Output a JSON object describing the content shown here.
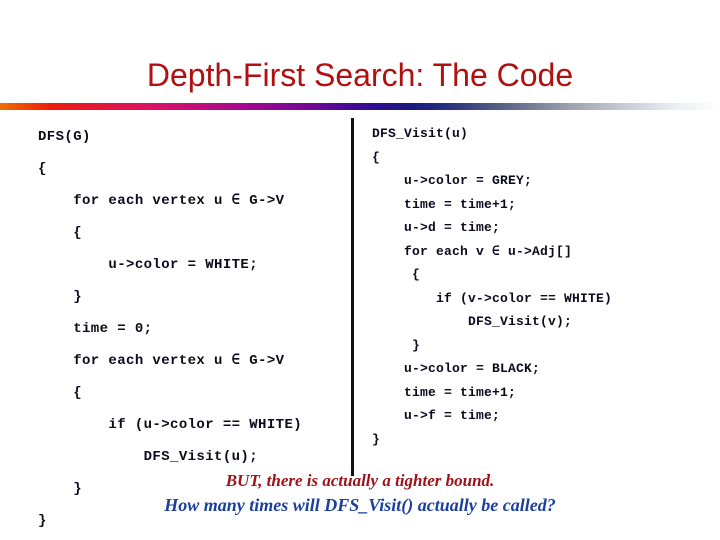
{
  "slide": {
    "title": "Depth-First Search: The Code",
    "title_color": "#b01010",
    "background_color": "#ffffff",
    "divider_color": "#111111"
  },
  "rule": {
    "name": "title-gradient-rule",
    "stops": [
      "#f07000",
      "#ee1b0c",
      "#d9106a",
      "#a9088e",
      "#7a0697",
      "#3b0b95",
      "#161a80",
      "#5a6386",
      "#9aa0ac",
      "#c9cdd6",
      "#ffffff"
    ]
  },
  "code_left": {
    "name": "DFS",
    "color": "#0b0b1e",
    "lines": [
      "DFS(G)",
      "{",
      "    for each vertex u ∈ G->V",
      "    {",
      "        u->color = WHITE;",
      "    }",
      "    time = 0;",
      "    for each vertex u ∈ G->V",
      "    {",
      "        if (u->color == WHITE)",
      "            DFS_Visit(u);",
      "    }",
      "}"
    ]
  },
  "code_right": {
    "name": "DFS_Visit",
    "color": "#0b0b1e",
    "lines": [
      "DFS_Visit(u)",
      "{",
      "    u->color = GREY;",
      "    time = time+1;",
      "    u->d = time;",
      "    for each v ∈ u->Adj[]",
      "     {",
      "        if (v->color == WHITE)",
      "            DFS_Visit(v);",
      "     }",
      "    u->color = BLACK;",
      "    time = time+1;",
      "    u->f = time;",
      "}"
    ]
  },
  "notes": {
    "line1": "BUT, there is actually a tighter bound.",
    "line1_color": "#9e1118",
    "line2": "How many times will DFS_Visit() actually be called?",
    "line2_color": "#1a3f9e"
  }
}
